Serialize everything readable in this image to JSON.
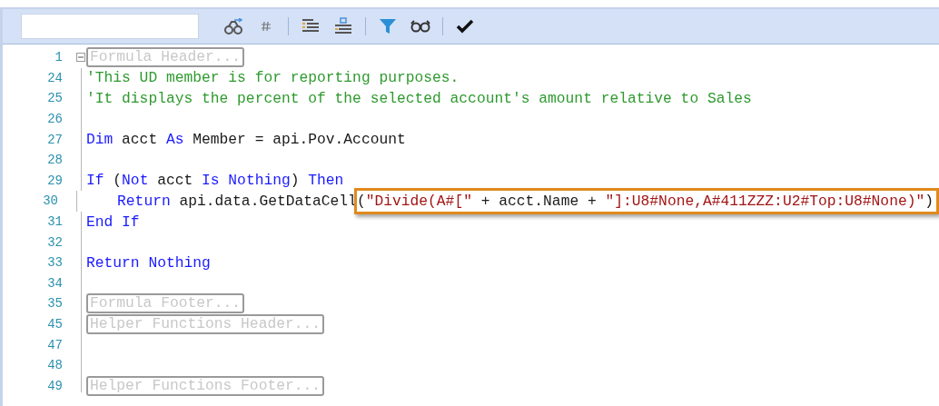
{
  "lines": [
    {
      "number": "1",
      "fold": true,
      "parts": [
        {
          "kind": "region",
          "text": "Formula Header..."
        }
      ]
    },
    {
      "number": "24",
      "parts": [
        {
          "kind": "code",
          "tokens": [
            {
              "kind": "comment",
              "text": "'This UD member is for reporting purposes."
            }
          ]
        }
      ]
    },
    {
      "number": "25",
      "parts": [
        {
          "kind": "code",
          "tokens": [
            {
              "kind": "comment",
              "text": "'It displays the percent of the selected account's amount relative to Sales"
            }
          ]
        }
      ]
    },
    {
      "number": "26"
    },
    {
      "number": "27",
      "parts": [
        {
          "kind": "code",
          "tokens": [
            {
              "kind": "keyword",
              "text": "Dim"
            },
            {
              "kind": "plain",
              "text": " acct "
            },
            {
              "kind": "keyword",
              "text": "As"
            },
            {
              "kind": "plain",
              "text": " Member = api.Pov.Account"
            }
          ]
        }
      ]
    },
    {
      "number": "28"
    },
    {
      "number": "29",
      "parts": [
        {
          "kind": "code",
          "tokens": [
            {
              "kind": "keyword",
              "text": "If"
            },
            {
              "kind": "plain",
              "text": " ("
            },
            {
              "kind": "keyword",
              "text": "Not"
            },
            {
              "kind": "plain",
              "text": " acct "
            },
            {
              "kind": "keyword",
              "text": "Is Nothing"
            },
            {
              "kind": "plain",
              "text": ") "
            },
            {
              "kind": "keyword",
              "text": "Then"
            }
          ]
        }
      ]
    },
    {
      "number": "30",
      "parts": [
        {
          "kind": "code",
          "indented": true,
          "tokens": [
            {
              "kind": "keyword",
              "text": "Return"
            },
            {
              "kind": "plain",
              "text": " api.data.GetDataCell"
            }
          ]
        },
        {
          "kind": "highlight",
          "tokens": [
            {
              "kind": "plain",
              "text": "("
            },
            {
              "kind": "string",
              "text": "\"Divide(A#[\""
            },
            {
              "kind": "plain",
              "text": " + acct.Name + "
            },
            {
              "kind": "string",
              "text": "\"]:U8#None,A#411ZZZ:U2#Top:U8#None)\""
            },
            {
              "kind": "plain",
              "text": ")"
            }
          ]
        }
      ]
    },
    {
      "number": "31",
      "parts": [
        {
          "kind": "code",
          "tokens": [
            {
              "kind": "keyword",
              "text": "End If"
            }
          ]
        }
      ]
    },
    {
      "number": "32"
    },
    {
      "number": "33",
      "parts": [
        {
          "kind": "code",
          "tokens": [
            {
              "kind": "keyword",
              "text": "Return Nothing"
            }
          ]
        }
      ]
    },
    {
      "number": "34"
    },
    {
      "number": "35",
      "parts": [
        {
          "kind": "region",
          "text": "Formula Footer..."
        }
      ]
    },
    {
      "number": "45",
      "parts": [
        {
          "kind": "region",
          "text": "Helper Functions Header..."
        }
      ]
    },
    {
      "number": "47"
    },
    {
      "number": "48"
    },
    {
      "number": "49",
      "parts": [
        {
          "kind": "region",
          "text": "Helper Functions Footer..."
        }
      ]
    }
  ]
}
